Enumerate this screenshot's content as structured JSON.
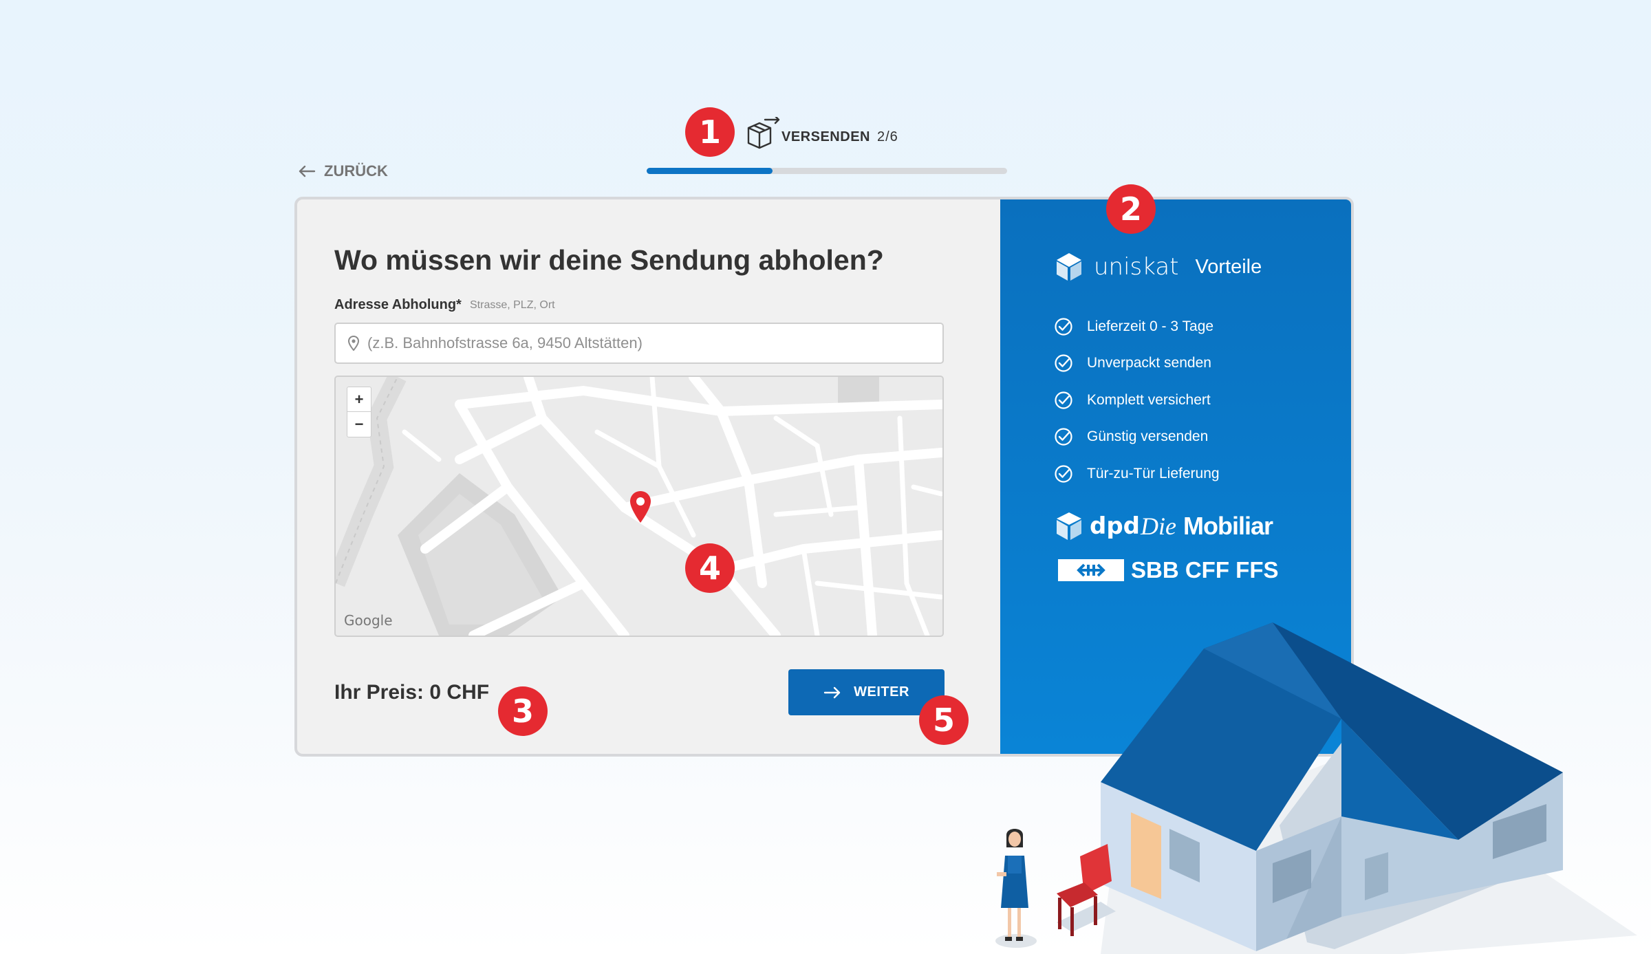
{
  "steps": {
    "label": "VERSENDEN",
    "count": "2/6",
    "progress": 0.35,
    "icon": "package-send-icon"
  },
  "nav": {
    "back_label": "ZURÜCK",
    "back_icon": "arrow-left-icon"
  },
  "form": {
    "title": "Wo müssen wir deine Sendung abholen?",
    "address_label": "Adresse Abholung*",
    "address_hint": "Strasse, PLZ, Ort",
    "address_placeholder": "(z.B. Bahnhofstrasse 6a, 9450 Altstätten)",
    "address_value": ""
  },
  "map": {
    "zoom_in": "+",
    "zoom_out": "−",
    "attribution": "Google",
    "marker_icon": "map-pin-icon"
  },
  "footer": {
    "price_label": "Ihr Preis: 0 CHF",
    "next_label": "WEITER",
    "next_icon": "arrow-right-icon"
  },
  "sidebar": {
    "brand": "uniskat",
    "heading": "Vorteile",
    "benefits": [
      "Lieferzeit 0 - 3 Tage",
      "Unverpackt senden",
      "Komplett versichert",
      "Günstig versenden",
      "Tür-zu-Tür Lieferung"
    ],
    "partners": {
      "dpd": "dpd",
      "mobiliar_die": "Die",
      "mobiliar_name": "Mobiliar",
      "sbb": "SBB CFF FFS"
    }
  },
  "annotations": [
    "1",
    "2",
    "3",
    "4",
    "5"
  ],
  "colors": {
    "primary": "#0d69b5",
    "panel": "#0a78c8",
    "badge": "#e52a31",
    "card_bg": "#f1f1f1",
    "text": "#333333"
  }
}
